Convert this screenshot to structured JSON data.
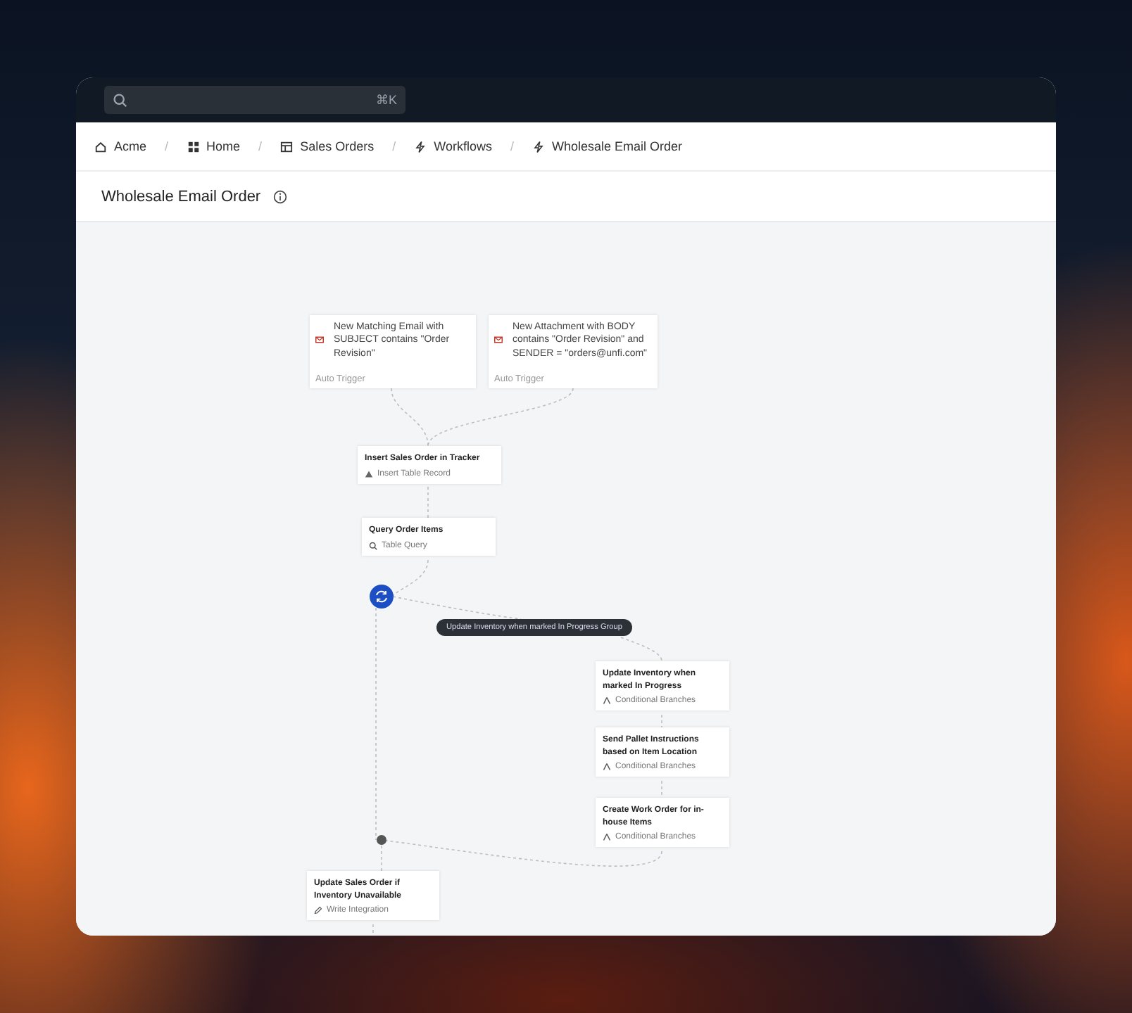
{
  "search": {
    "shortcut": "⌘K"
  },
  "breadcrumbs": [
    {
      "label": "Acme",
      "kind": "org"
    },
    {
      "label": "Home",
      "kind": "app"
    },
    {
      "label": "Sales Orders",
      "kind": "table"
    },
    {
      "label": "Workflows",
      "kind": "workflow"
    },
    {
      "label": "Wholesale Email Order",
      "kind": "workflow"
    }
  ],
  "breadcrumb_separator": "/",
  "page_title": "Wholesale Email Order",
  "nodes": [
    {
      "kind": "trigger",
      "title": "New Matching Email with SUBJECT contains \"Order Revision\"",
      "subtitle": "Auto Trigger"
    },
    {
      "kind": "trigger",
      "title": "New Attachment with BODY contains \"Order Revision\" and SENDER = \"orders@unfi.com\"",
      "subtitle": "Auto Trigger"
    },
    {
      "kind": "insert",
      "title": "Insert Sales Order in Tracker",
      "subtitle": "Insert Table Record"
    },
    {
      "kind": "query",
      "title": "Query Order Items",
      "subtitle": "Table Query"
    },
    {
      "kind": "branch",
      "title": "Update Inventory when marked In Progress",
      "subtitle": "Conditional Branches"
    },
    {
      "kind": "branch",
      "title": "Send Pallet Instructions based on Item Location",
      "subtitle": "Conditional Branches"
    },
    {
      "kind": "branch",
      "title": "Create Work Order for in-house Items",
      "subtitle": "Conditional Branches"
    },
    {
      "kind": "write",
      "title": "Update Sales Order if Inventory Unavailable",
      "subtitle": "Write Integration"
    }
  ],
  "group_label": "Update Inventory when marked In Progress Group"
}
